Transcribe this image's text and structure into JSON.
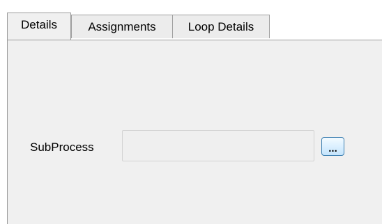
{
  "tabs": [
    {
      "label": "Details",
      "active": true
    },
    {
      "label": "Assignments",
      "active": false
    },
    {
      "label": "Loop Details",
      "active": false
    }
  ],
  "form": {
    "subprocess_label": "SubProcess",
    "subprocess_value": "",
    "browse_label": "..."
  }
}
